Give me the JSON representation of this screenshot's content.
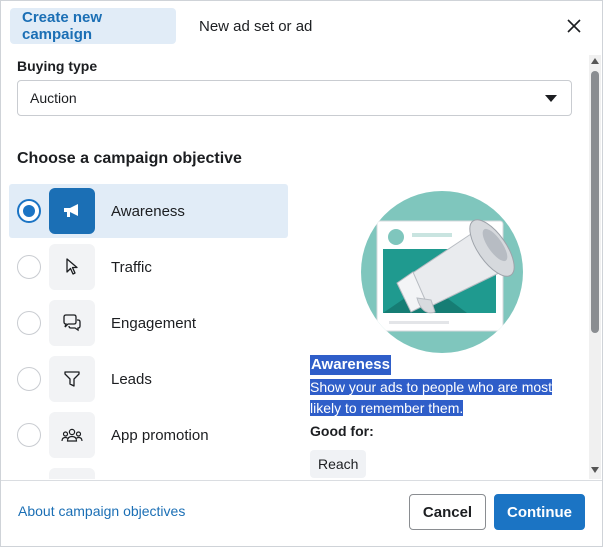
{
  "header": {
    "tabs": [
      {
        "label": "Create new campaign",
        "active": true
      },
      {
        "label": "New ad set or ad",
        "active": false
      }
    ],
    "close_icon": "close-icon"
  },
  "buying_type": {
    "label": "Buying type",
    "value": "Auction"
  },
  "objectives": {
    "title": "Choose a campaign objective",
    "items": [
      {
        "label": "Awareness",
        "icon": "megaphone-icon",
        "selected": true
      },
      {
        "label": "Traffic",
        "icon": "cursor-icon",
        "selected": false
      },
      {
        "label": "Engagement",
        "icon": "chat-bubbles-icon",
        "selected": false
      },
      {
        "label": "Leads",
        "icon": "funnel-icon",
        "selected": false
      },
      {
        "label": "App promotion",
        "icon": "people-icon",
        "selected": false
      },
      {
        "label": "",
        "icon": "shopping-bag-icon",
        "selected": false
      }
    ]
  },
  "detail": {
    "title": "Awareness",
    "description": "Show your ads to people who are most likely to remember them.",
    "good_for_label": "Good for:",
    "chips": [
      "Reach"
    ]
  },
  "footer": {
    "about_link": "About campaign objectives",
    "cancel_label": "Cancel",
    "continue_label": "Continue"
  },
  "colors": {
    "accent": "#1b74c4",
    "selected_bg": "#e1ecf7",
    "illustration_teal": "#7fc6bd"
  }
}
